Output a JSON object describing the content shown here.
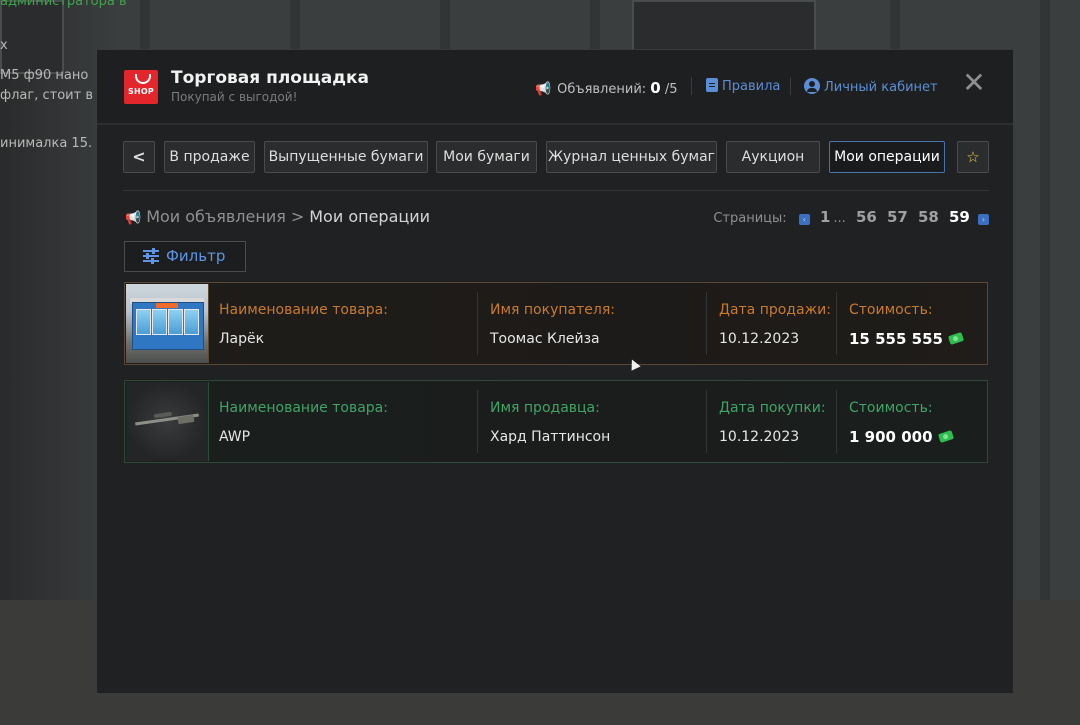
{
  "background": {
    "lines": [
      "администратора в",
      "x",
      "M5 ф90 нано",
      "флаг, стоит в",
      "инималка 15."
    ]
  },
  "header": {
    "logo_text": "SHOP",
    "title": "Торговая площадка",
    "subtitle": "Покупай с выгодой!",
    "ads_label": "Объявлений:",
    "ads_count": "0",
    "ads_max": "/5",
    "rules_label": "Правила",
    "cabinet_label": "Личный кабинет",
    "close_glyph": "✕"
  },
  "tabs": {
    "back_glyph": "<",
    "items": [
      {
        "label": "В продаже"
      },
      {
        "label": "Выпущенные бумаги"
      },
      {
        "label": "Мои бумаги"
      },
      {
        "label": "Журнал ценных бумаг"
      },
      {
        "label": "Аукцион"
      },
      {
        "label": "Мои операции"
      }
    ],
    "active_index": 5,
    "favorite_glyph": "☆"
  },
  "breadcrumb": {
    "root": "Мои объявления",
    "separator": ">",
    "current": "Мои операции"
  },
  "pagination": {
    "label": "Страницы:",
    "pages": [
      "1",
      "...",
      "56",
      "57",
      "58",
      "59"
    ],
    "current": "59",
    "prev_glyph": "‹",
    "next_glyph": "›"
  },
  "filter": {
    "label": "Фильтр"
  },
  "operations": [
    {
      "type": "sale",
      "item_label": "Наименование товара:",
      "item_value": "Ларёк",
      "person_label": "Имя покупателя:",
      "person_value": "Тоомас Клейза",
      "date_label": "Дата продажи:",
      "date_value": "10.12.2023",
      "price_label": "Стоимость:",
      "price_value": "15 555 555",
      "accent_color": "#c77a2e"
    },
    {
      "type": "purchase",
      "item_label": "Наименование товара:",
      "item_value": "AWP",
      "person_label": "Имя продавца:",
      "person_value": "Хард Паттинсон",
      "date_label": "Дата покупки:",
      "date_value": "10.12.2023",
      "price_label": "Стоимость:",
      "price_value": "1 900 000",
      "accent_color": "#3fa466"
    }
  ],
  "icons": {
    "logo": "shop-bag-icon",
    "ads": "megaphone-icon",
    "rules": "clipboard-icon",
    "cabinet": "user-icon",
    "close": "close-icon",
    "filter": "sliders-icon",
    "money": "money-icon",
    "favorite": "star-icon"
  }
}
